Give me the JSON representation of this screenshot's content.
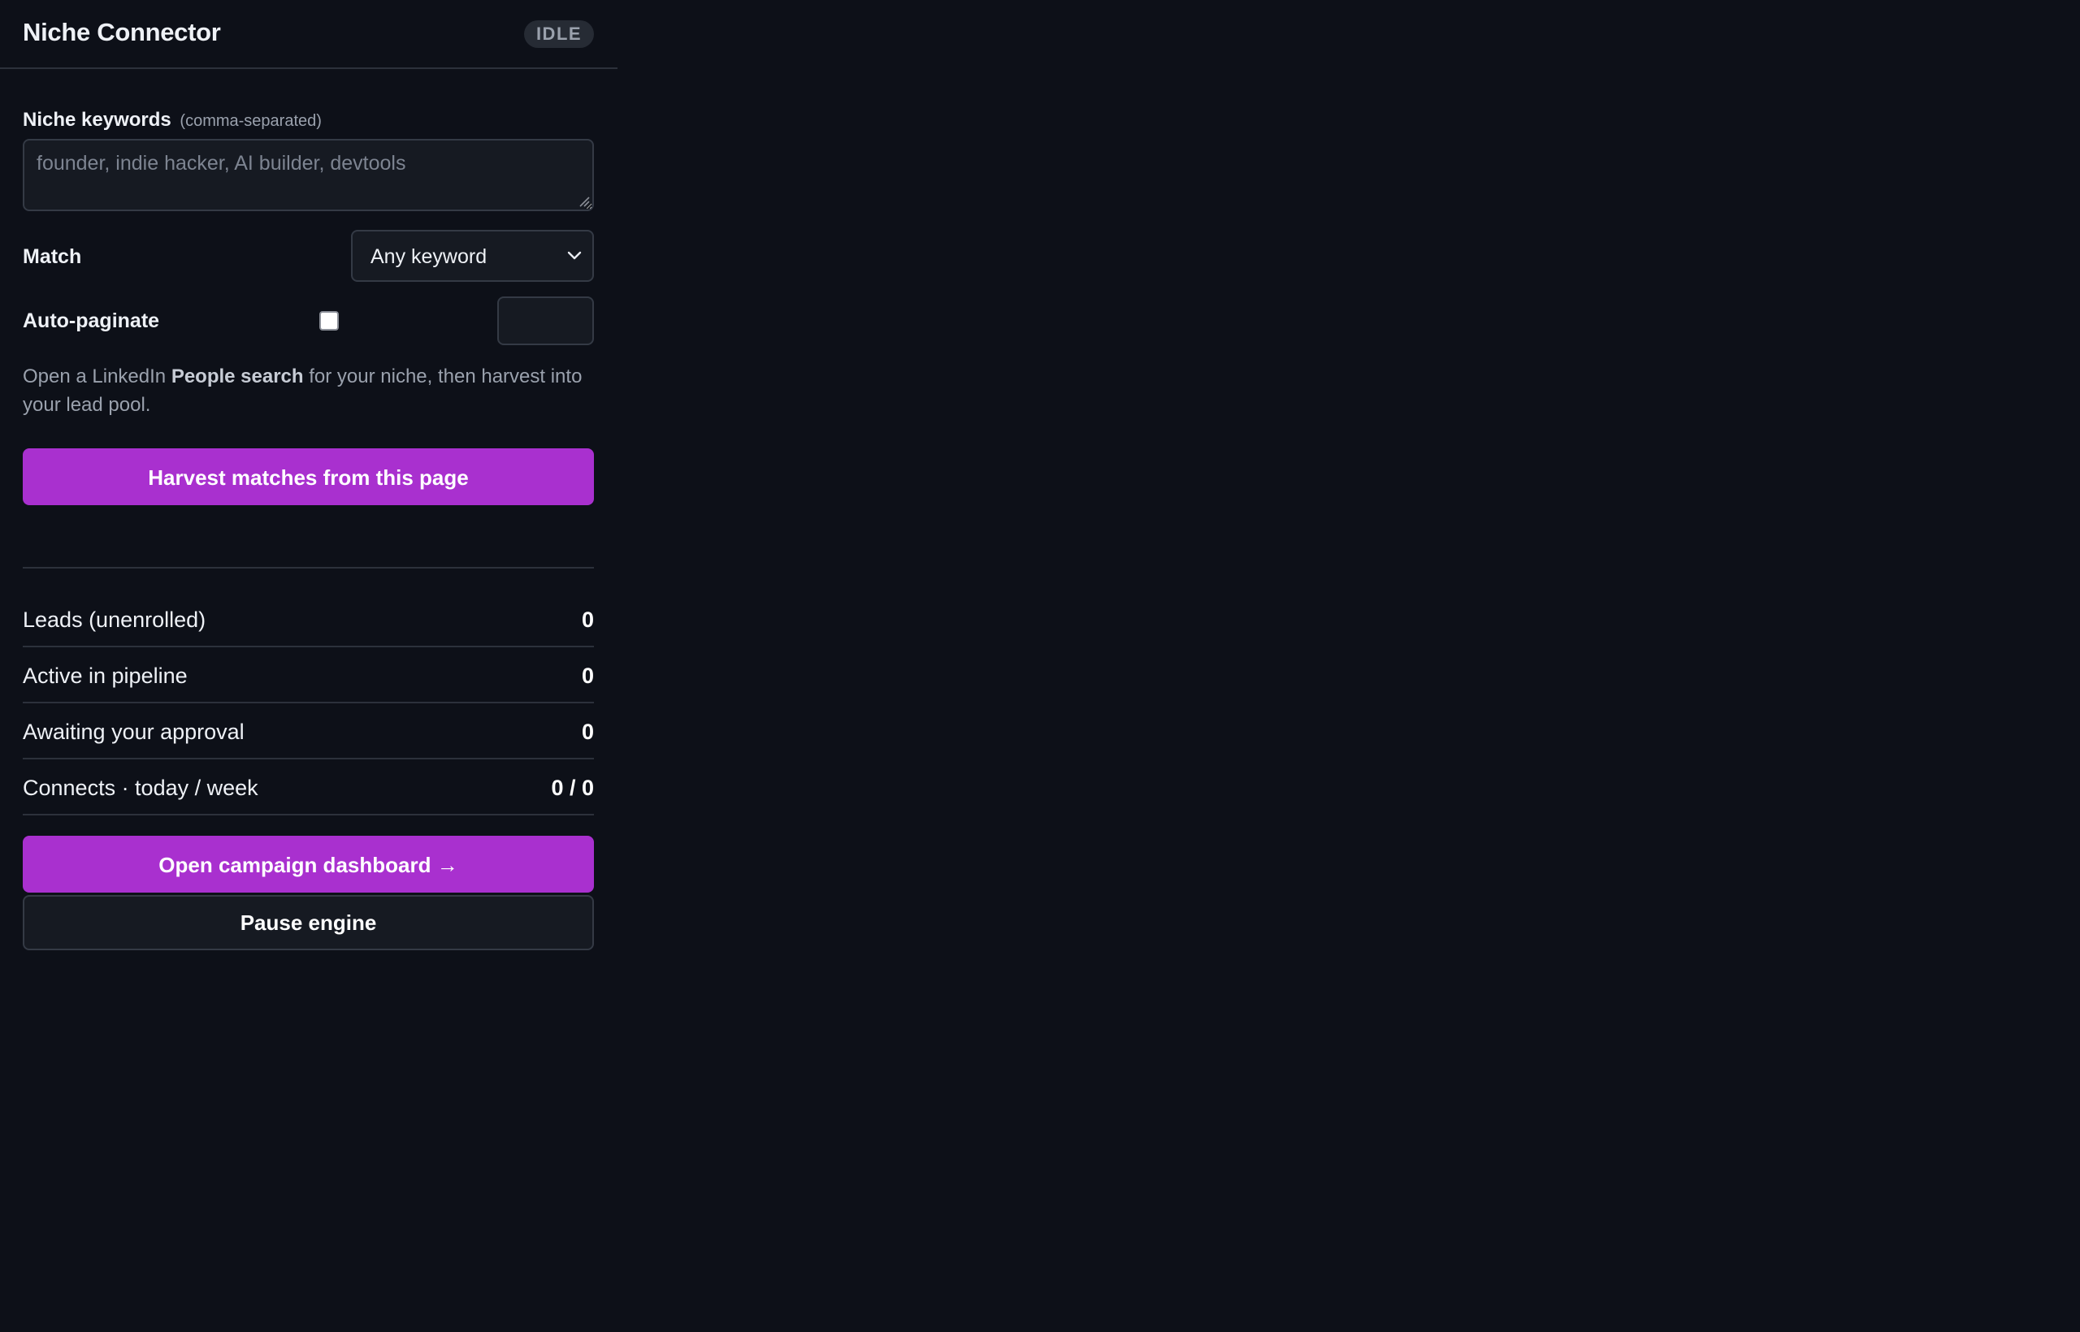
{
  "header": {
    "title": "Niche Connector",
    "status": "IDLE"
  },
  "keywords": {
    "label": "Niche keywords",
    "hint": "(comma-separated)",
    "value": "",
    "placeholder": "founder, indie hacker, AI builder, devtools"
  },
  "match": {
    "label": "Match",
    "selected": "Any keyword"
  },
  "autopaginate": {
    "label": "Auto-paginate",
    "checked": false,
    "pages_value": ""
  },
  "helper": {
    "prefix": "Open a LinkedIn ",
    "emphasis": "People search",
    "suffix": " for your niche, then harvest into your lead pool."
  },
  "actions": {
    "harvest_label": "Harvest matches from this page",
    "dashboard_label": "Open campaign dashboard →",
    "pause_label": "Pause engine"
  },
  "stats": [
    {
      "label": "Leads (unenrolled)",
      "value": "0"
    },
    {
      "label": "Active in pipeline",
      "value": "0"
    },
    {
      "label": "Awaiting your approval",
      "value": "0"
    },
    {
      "label": "Connects · today / week",
      "value": "0 / 0"
    }
  ],
  "colors": {
    "background": "#0d1018",
    "accent": "#a930cf",
    "surface": "#161a22",
    "border": "#343a45",
    "muted_text": "#9aa1ad"
  }
}
